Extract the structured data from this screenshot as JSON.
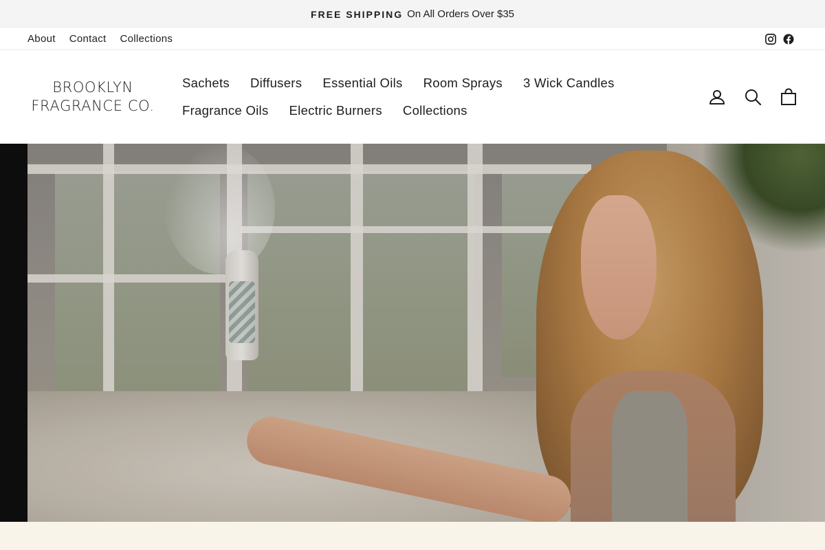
{
  "announcement": {
    "highlight": "FREE SHIPPING",
    "text": "On All Orders Over $35"
  },
  "utility": {
    "links": [
      {
        "label": "About"
      },
      {
        "label": "Contact"
      },
      {
        "label": "Collections"
      }
    ],
    "social": [
      {
        "icon": "instagram-icon"
      },
      {
        "icon": "facebook-icon"
      }
    ]
  },
  "header": {
    "logo_line1": "BROOKLYN",
    "logo_line2": "FRAGRANCE CO.",
    "nav": [
      {
        "label": "Sachets"
      },
      {
        "label": "Diffusers"
      },
      {
        "label": "Essential Oils"
      },
      {
        "label": "Room Sprays"
      },
      {
        "label": "3 Wick Candles"
      },
      {
        "label": "Fragrance Oils"
      },
      {
        "label": "Electric Burners"
      },
      {
        "label": "Collections"
      }
    ],
    "icons": [
      "account-icon",
      "search-icon",
      "cart-icon"
    ]
  },
  "colors": {
    "announcement_bg": "#f4f4f4",
    "text": "#1c1d1d",
    "hero_edge": "#0d0d0d",
    "section_bg": "#f8f4ea"
  }
}
